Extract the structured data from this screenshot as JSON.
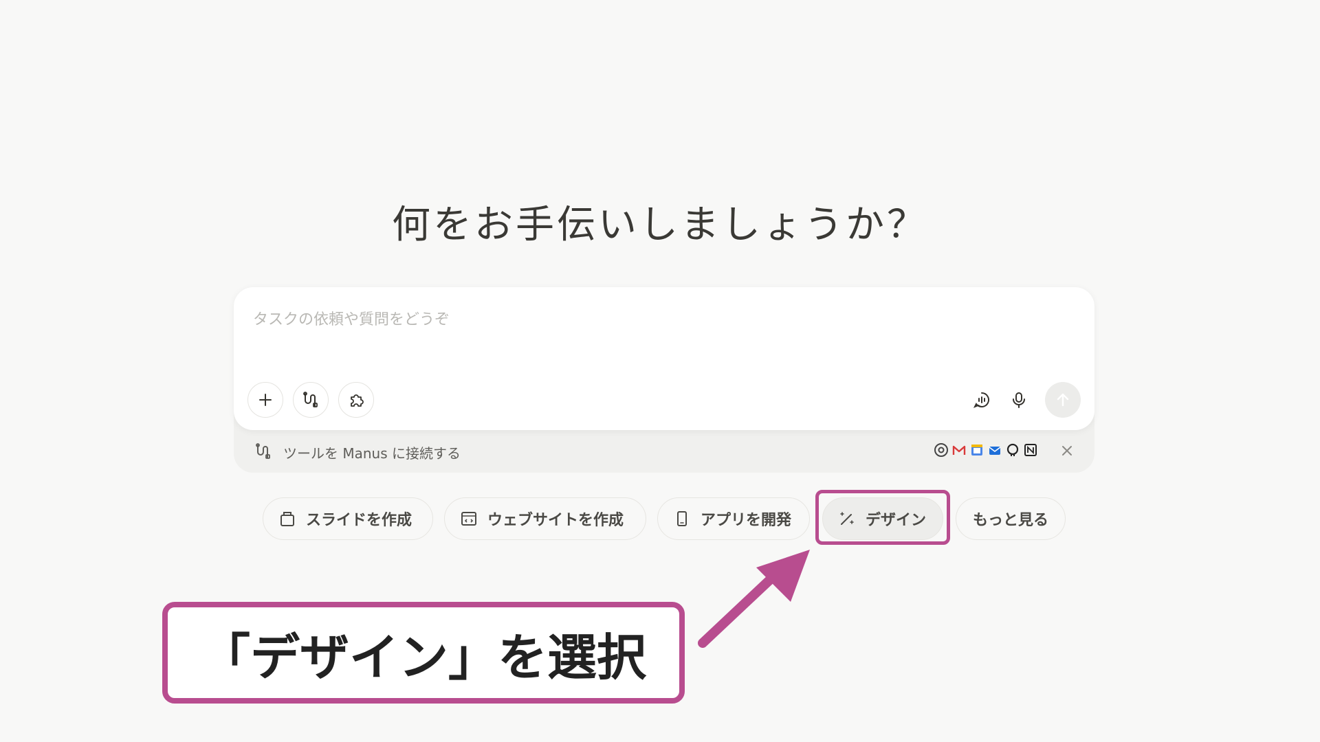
{
  "headline": "何をお手伝いしましょうか？",
  "composer": {
    "placeholder": "タスクの依頼や質問をどうぞ"
  },
  "connect_bar": {
    "label": "ツールを Manus に接続する"
  },
  "chips": [
    {
      "label": "スライドを作成"
    },
    {
      "label": "ウェブサイトを作成"
    },
    {
      "label": "アプリを開発"
    },
    {
      "label": "デザイン"
    },
    {
      "label": "もっと見る"
    }
  ],
  "annotation": {
    "callout_text": "「デザイン」を選択",
    "accent_color": "#b84d8f"
  },
  "icons": {
    "add": "plus-icon",
    "tools": "connector-icon",
    "plugins": "puzzle-icon",
    "speech": "chat-voice-icon",
    "mic": "microphone-icon",
    "send": "arrow-up-icon",
    "close": "close-icon"
  }
}
